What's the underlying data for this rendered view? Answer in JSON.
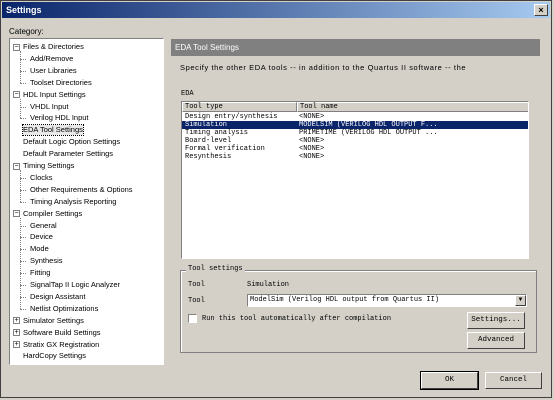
{
  "window": {
    "title": "Settings",
    "close_glyph": "×"
  },
  "category_label": "Category:",
  "tree": [
    {
      "label": "Files & Directories",
      "indent": 0,
      "expander": "−"
    },
    {
      "label": "Add/Remove",
      "indent": 1
    },
    {
      "label": "User Libraries",
      "indent": 1
    },
    {
      "label": "Toolset Directories",
      "indent": 1
    },
    {
      "label": "HDL Input Settings",
      "indent": 0,
      "expander": "−"
    },
    {
      "label": "VHDL Input",
      "indent": 1
    },
    {
      "label": "Verilog HDL Input",
      "indent": 1
    },
    {
      "label": "EDA Tool Settings",
      "indent": 0,
      "selected": true
    },
    {
      "label": "Default Logic Option Settings",
      "indent": 0
    },
    {
      "label": "Default Parameter Settings",
      "indent": 0
    },
    {
      "label": "Timing Settings",
      "indent": 0,
      "expander": "−"
    },
    {
      "label": "Clocks",
      "indent": 1
    },
    {
      "label": "Other Requirements & Options",
      "indent": 1
    },
    {
      "label": "Timing Analysis Reporting",
      "indent": 1
    },
    {
      "label": "Compiler Settings",
      "indent": 0,
      "expander": "−"
    },
    {
      "label": "General",
      "indent": 1
    },
    {
      "label": "Device",
      "indent": 1
    },
    {
      "label": "Mode",
      "indent": 1
    },
    {
      "label": "Synthesis",
      "indent": 1
    },
    {
      "label": "Fitting",
      "indent": 1
    },
    {
      "label": "SignalTap II Logic Analyzer",
      "indent": 1
    },
    {
      "label": "Design Assistant",
      "indent": 1
    },
    {
      "label": "Netlist Optimizations",
      "indent": 1
    },
    {
      "label": "Simulator Settings",
      "indent": 0,
      "expander": "+"
    },
    {
      "label": "Software Build Settings",
      "indent": 0,
      "expander": "+"
    },
    {
      "label": "Stratix GX Registration",
      "indent": 0,
      "expander": "+"
    },
    {
      "label": "HardCopy Settings",
      "indent": 0
    }
  ],
  "panel": {
    "header": "EDA Tool Settings",
    "description": "Specify the other EDA tools -- in addition to the Quartus II software -- the",
    "eda_group_label": "EDA",
    "columns": [
      "Tool type",
      "Tool name"
    ],
    "rows": [
      {
        "type": "Design entry/synthesis",
        "name": "<NONE>"
      },
      {
        "type": "Simulation",
        "name": "MODELSIM (VERILOG HDL OUTPUT F...",
        "selected": true
      },
      {
        "type": "Timing analysis",
        "name": "PRIMETIME (VERILOG HDL OUTPUT ...",
        "selected": false
      },
      {
        "type": "Board-level",
        "name": "<NONE>"
      },
      {
        "type": "Formal verification",
        "name": "<NONE>"
      },
      {
        "type": "Resynthesis",
        "name": "<NONE>"
      }
    ],
    "tool_settings": {
      "title": "Tool settings",
      "tool_label": "Tool",
      "tool_value": "Simulation",
      "tool2_label": "Tool",
      "combo_value": "ModelSim (Verilog HDL output from Quartus II)",
      "checkbox_label": "Run this tool automatically after compilation",
      "checkbox_checked": false,
      "settings_button": "Settings...",
      "advanced_button": "Advanced"
    }
  },
  "buttons": {
    "ok": "OK",
    "cancel": "Cancel"
  }
}
